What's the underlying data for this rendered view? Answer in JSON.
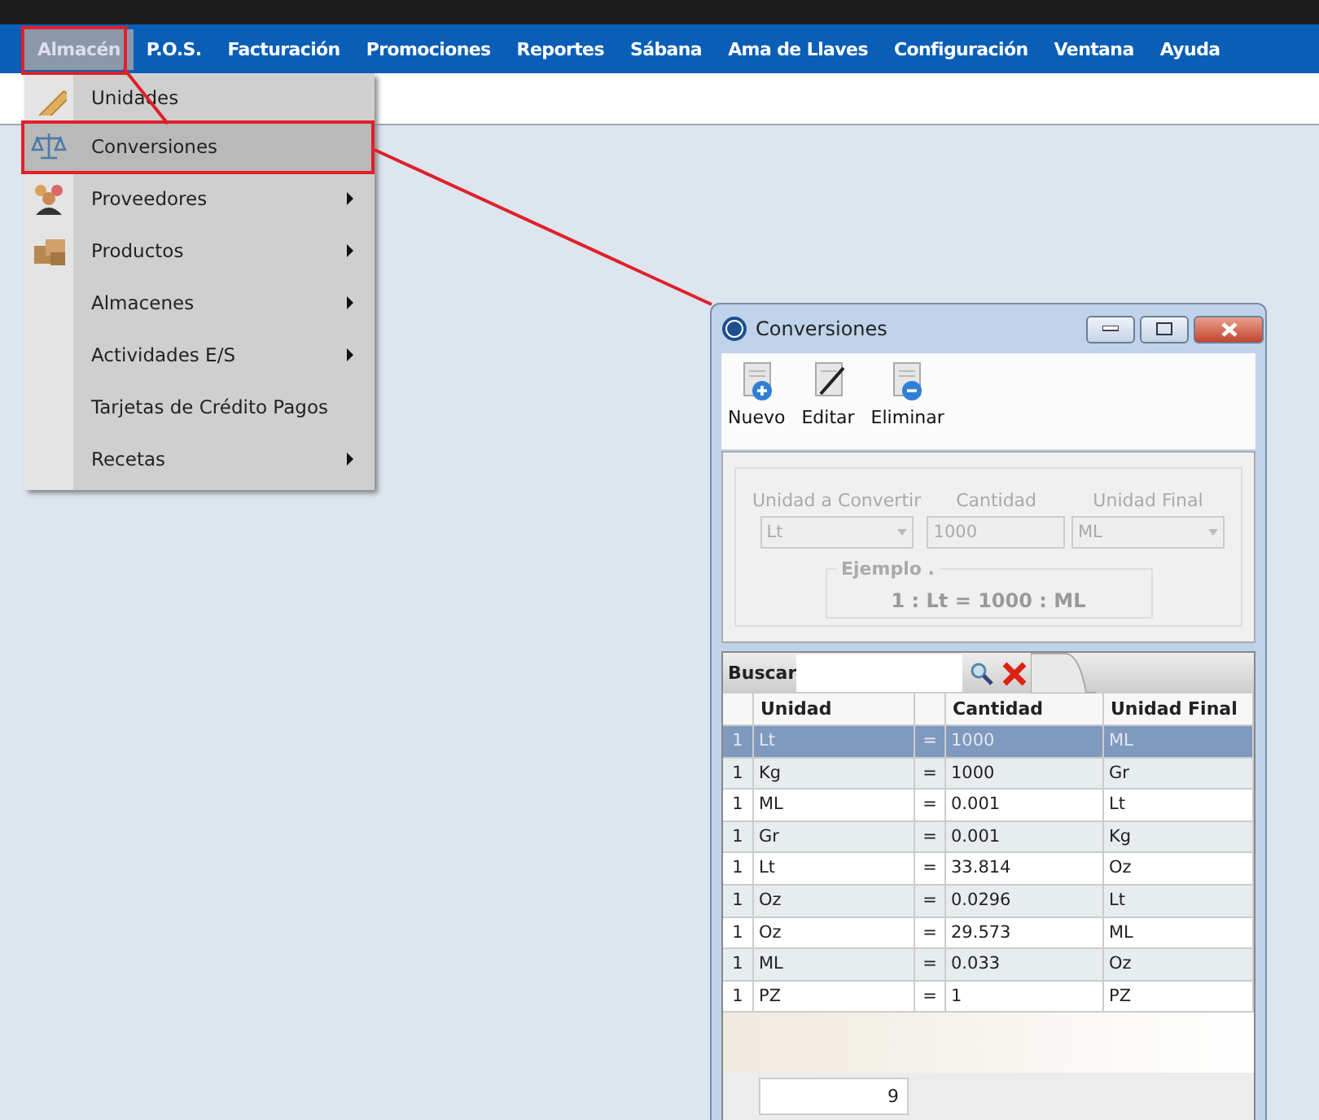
{
  "menu_bar": {
    "items": [
      {
        "label": "Almacén",
        "selected": true
      },
      {
        "label": "P.O.S.",
        "selected": false
      },
      {
        "label": "Facturación",
        "selected": false
      },
      {
        "label": "Promociones",
        "selected": false
      },
      {
        "label": "Reportes",
        "selected": false
      },
      {
        "label": "Sábana",
        "selected": false
      },
      {
        "label": "Ama de Llaves",
        "selected": false
      },
      {
        "label": "Configuración",
        "selected": false
      },
      {
        "label": "Ventana",
        "selected": false
      },
      {
        "label": "Ayuda",
        "selected": false
      }
    ]
  },
  "dropdown": {
    "items": [
      {
        "label": "Unidades",
        "has_submenu": false,
        "selected": false
      },
      {
        "label": "Conversiones",
        "has_submenu": false,
        "selected": true
      },
      {
        "label": "Proveedores",
        "has_submenu": true,
        "selected": false
      },
      {
        "label": "Productos",
        "has_submenu": true,
        "selected": false
      },
      {
        "label": "Almacenes",
        "has_submenu": true,
        "selected": false
      },
      {
        "label": "Actividades E/S",
        "has_submenu": true,
        "selected": false
      },
      {
        "label": "Tarjetas de Crédito Pagos",
        "has_submenu": false,
        "selected": false
      },
      {
        "label": "Recetas",
        "has_submenu": true,
        "selected": false
      }
    ]
  },
  "window": {
    "title": "Conversiones",
    "toolbar": [
      {
        "label": "Nuevo",
        "kind": "add"
      },
      {
        "label": "Editar",
        "kind": "edit"
      },
      {
        "label": "Eliminar",
        "kind": "remove"
      }
    ],
    "form": {
      "disabled": true,
      "fields": [
        {
          "label": "Unidad a Convertir",
          "value": "Lt",
          "kind": "select"
        },
        {
          "label": "Cantidad",
          "value": "1000",
          "kind": "text"
        },
        {
          "label": "Unidad Final",
          "value": "ML",
          "kind": "select"
        }
      ],
      "example": {
        "title": "Ejemplo .",
        "text": "1 : Lt = 1000 : ML"
      }
    },
    "search": {
      "label": "Buscar"
    },
    "table": {
      "columns": [
        {
          "label": "Unidad"
        },
        {
          "label": "Cantidad"
        },
        {
          "label": "Unidad Final"
        }
      ],
      "rows": [
        {
          "count": "1",
          "unit": "Lt",
          "sign": "=",
          "quantity": "1000",
          "final_unit": "ML",
          "selected": true
        },
        {
          "count": "1",
          "unit": "Kg",
          "sign": "=",
          "quantity": "1000",
          "final_unit": "Gr",
          "selected": false
        },
        {
          "count": "1",
          "unit": "ML",
          "sign": "=",
          "quantity": "0.001",
          "final_unit": "Lt",
          "selected": false
        },
        {
          "count": "1",
          "unit": "Gr",
          "sign": "=",
          "quantity": "0.001",
          "final_unit": "Kg",
          "selected": false
        },
        {
          "count": "1",
          "unit": "Lt",
          "sign": "=",
          "quantity": "33.814",
          "final_unit": "Oz",
          "selected": false
        },
        {
          "count": "1",
          "unit": "Oz",
          "sign": "=",
          "quantity": "0.0296",
          "final_unit": "Lt",
          "selected": false
        },
        {
          "count": "1",
          "unit": "Oz",
          "sign": "=",
          "quantity": "29.573",
          "final_unit": "ML",
          "selected": false
        },
        {
          "count": "1",
          "unit": "ML",
          "sign": "=",
          "quantity": "0.033",
          "final_unit": "Oz",
          "selected": false
        },
        {
          "count": "1",
          "unit": "PZ",
          "sign": "=",
          "quantity": "1",
          "final_unit": "PZ",
          "selected": false
        }
      ]
    },
    "footer": {
      "count": "9"
    }
  }
}
